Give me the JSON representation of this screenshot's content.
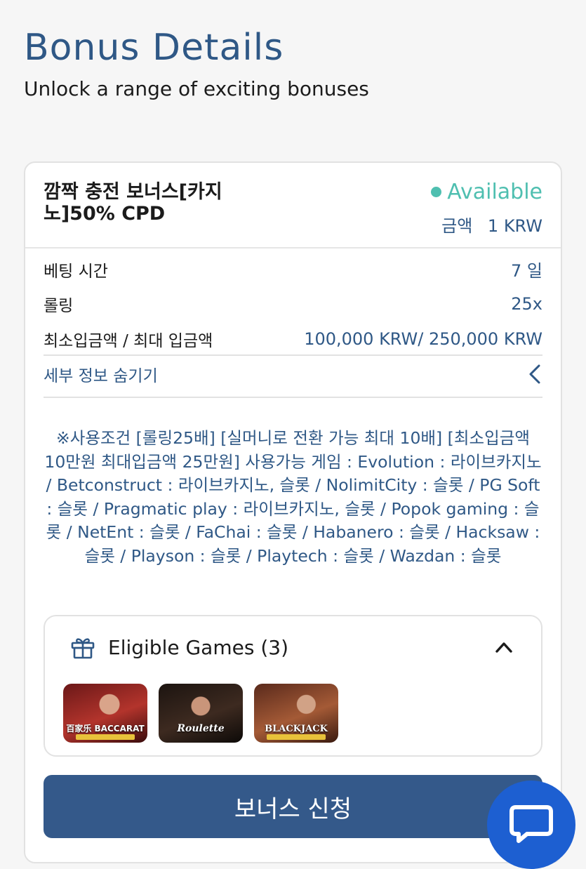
{
  "header": {
    "title": "Bonus Details",
    "subtitle": "Unlock a range of exciting bonuses"
  },
  "bonus": {
    "name": "깜짝 충전 보너스[카지노]50% CPD",
    "status": "Available",
    "amount_label": "금액",
    "amount_value": "1 KRW",
    "details": [
      {
        "label": "베팅 시간",
        "value": "7 일"
      },
      {
        "label": "롤링",
        "value": "25x"
      },
      {
        "label": "최소입금액 / 최대 입금액",
        "value": "100,000 KRW/ 250,000 KRW"
      }
    ],
    "toggle_label": "세부 정보 숨기기",
    "terms": "※사용조건 [롤링25배] [실머니로 전환 가능 최대 10배] [최소입금액 10만원 최대입금액 25만원] 사용가능 게임 : Evolution : 라이브카지노 / Betconstruct : 라이브카지노, 슬롯 / NolimitCity : 슬롯 / PG Soft : 슬롯 / Pragmatic play : 라이브카지노, 슬롯 / Popok gaming : 슬롯 / NetEnt : 슬롯 / FaChai : 슬롯 / Habanero : 슬롯 / Hacksaw : 슬롯 / Playson : 슬롯 / Playtech : 슬롯 / Wazdan : 슬롯"
  },
  "eligible_games": {
    "title": "Eligible Games (3)",
    "games": [
      {
        "label": "百家乐 BACCARAT",
        "icon": "baccarat-thumbnail"
      },
      {
        "label": "Roulette",
        "icon": "roulette-thumbnail"
      },
      {
        "label": "BLACKJACK",
        "icon": "blackjack-thumbnail"
      }
    ]
  },
  "apply_button": "보너스 신청",
  "colors": {
    "brand": "#2f5886",
    "status": "#4fbfb0",
    "button": "#34598a",
    "chat": "#1d5fd1"
  }
}
